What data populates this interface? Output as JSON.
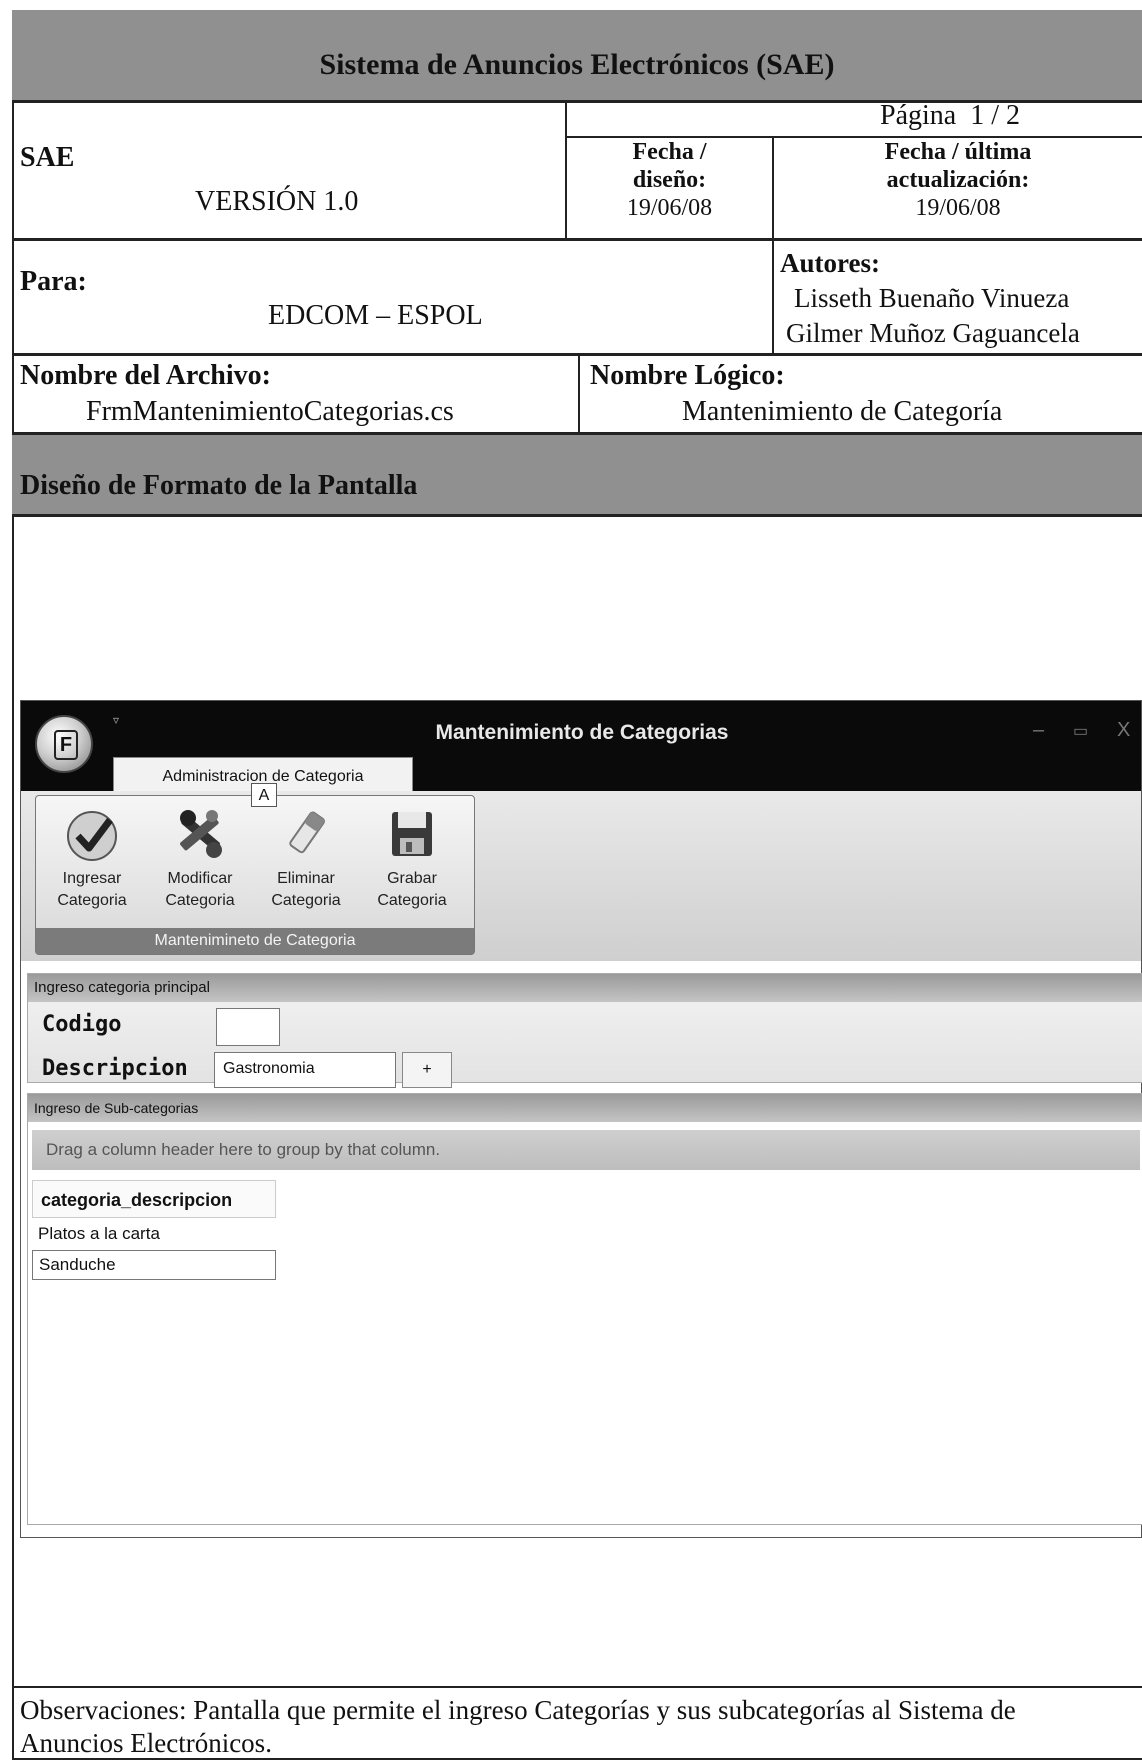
{
  "header": {
    "title": "Sistema de Anuncios Electrónicos (SAE)",
    "page": "Página  1 / 2",
    "system": "SAE",
    "version": "VERSIÓN 1.0",
    "design_date_label_1": "Fecha /",
    "design_date_label_2": "diseño:",
    "design_date": "19/06/08",
    "update_label_1": "Fecha / última",
    "update_label_2": "actualización:",
    "update_date": "19/06/08",
    "para_label": "Para:",
    "para_value": "EDCOM – ESPOL",
    "authors_label": "Autores:",
    "author_1": "Lisseth Buenaño Vinueza",
    "author_2": "Gilmer Muñoz Gaguancela",
    "file_label": "Nombre del Archivo:",
    "file_value": "FrmMantenimientoCategorias.cs",
    "logical_label": "Nombre Lógico:",
    "logical_value": "Mantenimiento de Categoría",
    "section": "Diseño de Formato de la Pantalla"
  },
  "app": {
    "window_title": "Mantenimiento de Categorias",
    "orb_letter": "F",
    "tab_label": "Administracion de Categoria",
    "keytip": "A",
    "ribbon_buttons": [
      {
        "line1": "Ingresar",
        "line2": "Categoria",
        "icon": "checkmark-icon"
      },
      {
        "line1": "Modificar",
        "line2": "Categoria",
        "icon": "tools-icon"
      },
      {
        "line1": "Eliminar",
        "line2": "Categoria",
        "icon": "eraser-icon"
      },
      {
        "line1": "Grabar",
        "line2": "Categoria",
        "icon": "floppy-disk-icon"
      }
    ],
    "group_caption": "Mantenimineto de Categoria",
    "main_panel_title": "Ingreso categoria principal",
    "codigo_label": "Codigo",
    "codigo_value": "",
    "descripcion_label": "Descripcion",
    "descripcion_value": "Gastronomia",
    "add_button": "+",
    "sub_panel_title": "Ingreso de Sub-categorias",
    "group_hint": "Drag a column header here to group by that column.",
    "grid_header": "categoria_descripcion",
    "grid_rows": [
      "Platos a la carta",
      "Sanduche"
    ]
  },
  "footer": {
    "observations": "Observaciones: Pantalla que permite el ingreso Categorías y sus subcategorías al Sistema de Anuncios Electrónicos."
  }
}
